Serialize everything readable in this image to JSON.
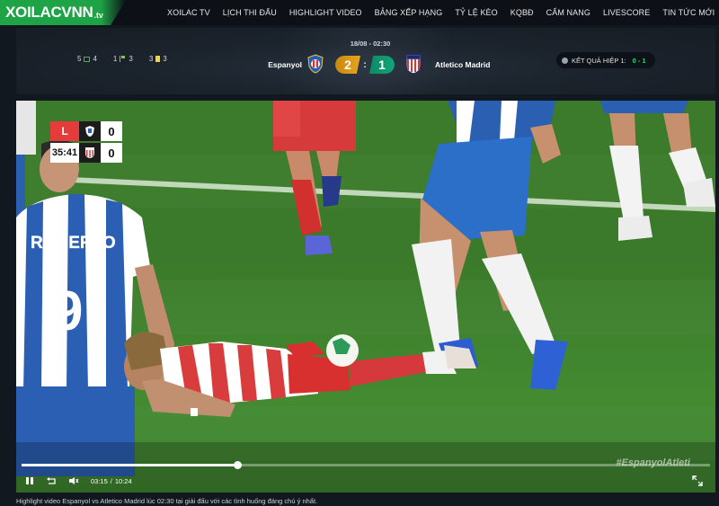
{
  "site": {
    "logo_main": "XOILACVNN",
    "logo_tld": ".tv"
  },
  "nav": [
    "XOILAC TV",
    "LỊCH THI ĐẤU",
    "HIGHLIGHT VIDEO",
    "BẢNG XẾP HẠNG",
    "TỶ LỆ KÈO",
    "KQBĐ",
    "CẨM NANG",
    "LIVESCORE",
    "TIN TỨC MỚI"
  ],
  "match": {
    "date": "18/08 - 02:30",
    "home": "Espanyol",
    "away": "Atletico Madrid",
    "home_score": "2",
    "separator": ":",
    "away_score": "1",
    "stats": {
      "corners_home": "5",
      "corners_away": "4",
      "offsides_home": "1",
      "offsides_away": "3",
      "cards_home": "3",
      "cards_away": "3"
    },
    "half_label": "KẾT QUẢ HIỆP 1:",
    "half_value": "0 - 1"
  },
  "broadcast": {
    "league_mark": "L",
    "clock": "35:41",
    "home_goals": "0",
    "away_goals": "0"
  },
  "player": {
    "name": "ROBERTO",
    "number": "9"
  },
  "video": {
    "current_time": "03:15",
    "time_sep": "/",
    "duration": "10:24",
    "progress": 0.313,
    "hashtag": "#EspanyolAtleti"
  },
  "caption": "Highlight video Espanyol vs Atletico Madrid lúc 02:30 tại giải đấu với các tình huống đáng chú ý nhất.",
  "colors": {
    "brand_green": "#1fa347",
    "home_score_bg": "#e6a51d",
    "away_score_bg": "#11a579",
    "half_result": "#2ed37a"
  }
}
